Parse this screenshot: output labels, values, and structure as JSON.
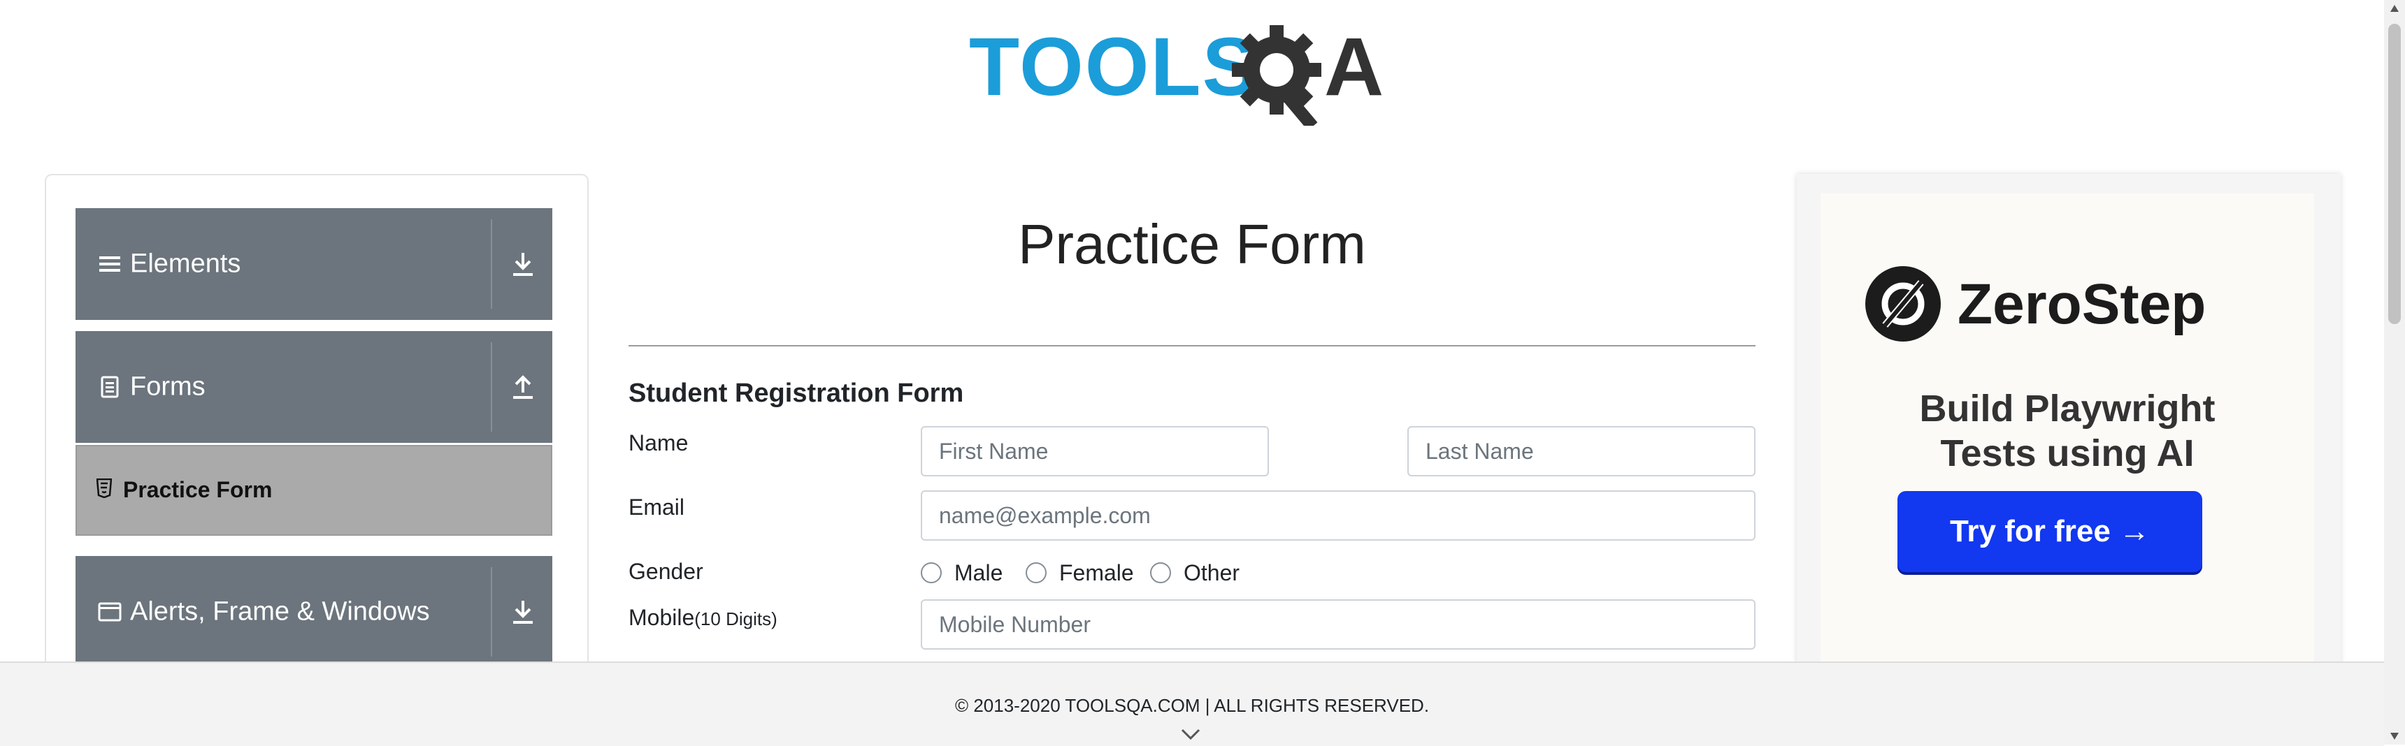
{
  "logo": {
    "text_tools": "TOOLS",
    "text_qa": "QA",
    "blue": "#1b9dd9",
    "dark": "#333333"
  },
  "sidebar": {
    "groups": [
      {
        "label": "Elements",
        "icon": "hamburger-icon",
        "toggle_icon": "download-arrow-icon"
      },
      {
        "label": "Forms",
        "icon": "document-icon",
        "toggle_icon": "upload-arrow-icon"
      },
      {
        "label": "Alerts, Frame & Windows",
        "icon": "window-icon",
        "toggle_icon": "download-arrow-icon"
      }
    ],
    "active_item": {
      "label": "Practice Form",
      "icon": "html5-icon"
    },
    "header_color": "#6c757d",
    "active_color": "#aaaaaa"
  },
  "main": {
    "title": "Practice Form",
    "form_heading": "Student Registration Form",
    "name_label": "Name",
    "first_name_placeholder": "First Name",
    "last_name_placeholder": "Last Name",
    "email_label": "Email",
    "email_placeholder": "name@example.com",
    "gender_label": "Gender",
    "gender_options": [
      "Male",
      "Female",
      "Other"
    ],
    "mobile_label": "Mobile",
    "mobile_hint": "(10 Digits)",
    "mobile_placeholder": "Mobile Number"
  },
  "ad": {
    "brand": "ZeroStep",
    "tagline_line1": "Build Playwright",
    "tagline_line2": "Tests using AI",
    "button_label": "Try for free →",
    "button_color": "#1238f0"
  },
  "footer": {
    "text": "© 2013-2020 TOOLSQA.COM | ALL RIGHTS RESERVED."
  }
}
